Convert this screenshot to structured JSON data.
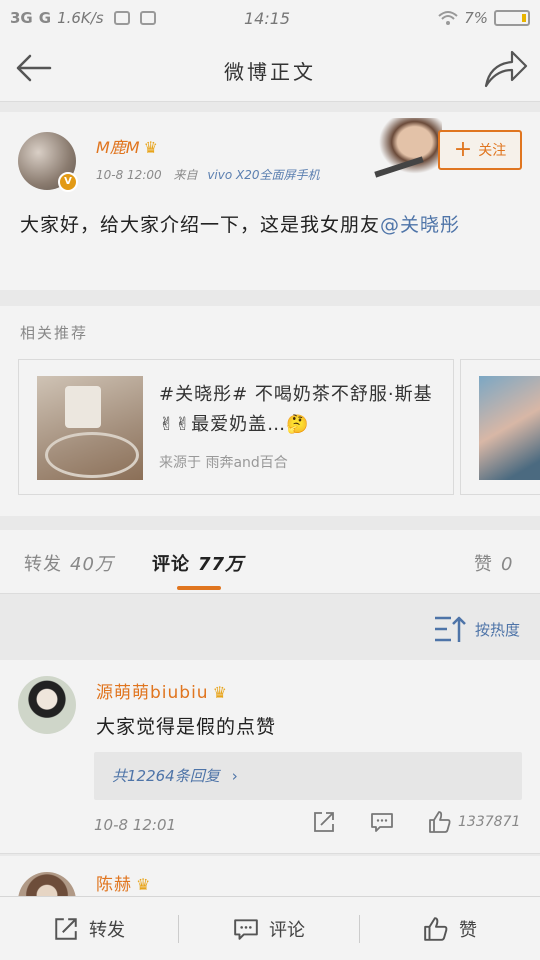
{
  "status": {
    "signal1": "3G",
    "signal2": "G",
    "speed": "1.6K/s",
    "time": "14:15",
    "battery": "7%"
  },
  "header": {
    "title": "微博正文"
  },
  "post": {
    "author": "M鹿M",
    "meta_time": "10-8 12:00",
    "meta_from": "来自",
    "meta_source": "vivo X20全面屏手机",
    "follow_label": "关注",
    "text_main": "大家好，给大家介绍一下，这是我女朋友",
    "mention": "@关晓彤"
  },
  "related": {
    "label": "相关推荐",
    "card": {
      "title": "#关晓彤# 不喝奶茶不舒服·斯基✌✌最爱奶盖…🤔",
      "source": "来源于 雨奔and百合"
    }
  },
  "tabs": [
    {
      "label": "转发",
      "count": "40万"
    },
    {
      "label": "评论",
      "count": "77万"
    },
    {
      "label": "赞",
      "count": "0"
    }
  ],
  "sort": {
    "label": "按热度"
  },
  "comments": [
    {
      "name": "源萌萌biubiu",
      "text": "大家觉得是假的点赞",
      "replies": "共12264条回复",
      "time": "10-8 12:01",
      "likes": "1337871"
    },
    {
      "name": "陈赫"
    }
  ],
  "bottom": {
    "repost": "转发",
    "comment": "评论",
    "like": "赞"
  },
  "colors": {
    "accent": "#e0751f",
    "link": "#4e74a8"
  }
}
